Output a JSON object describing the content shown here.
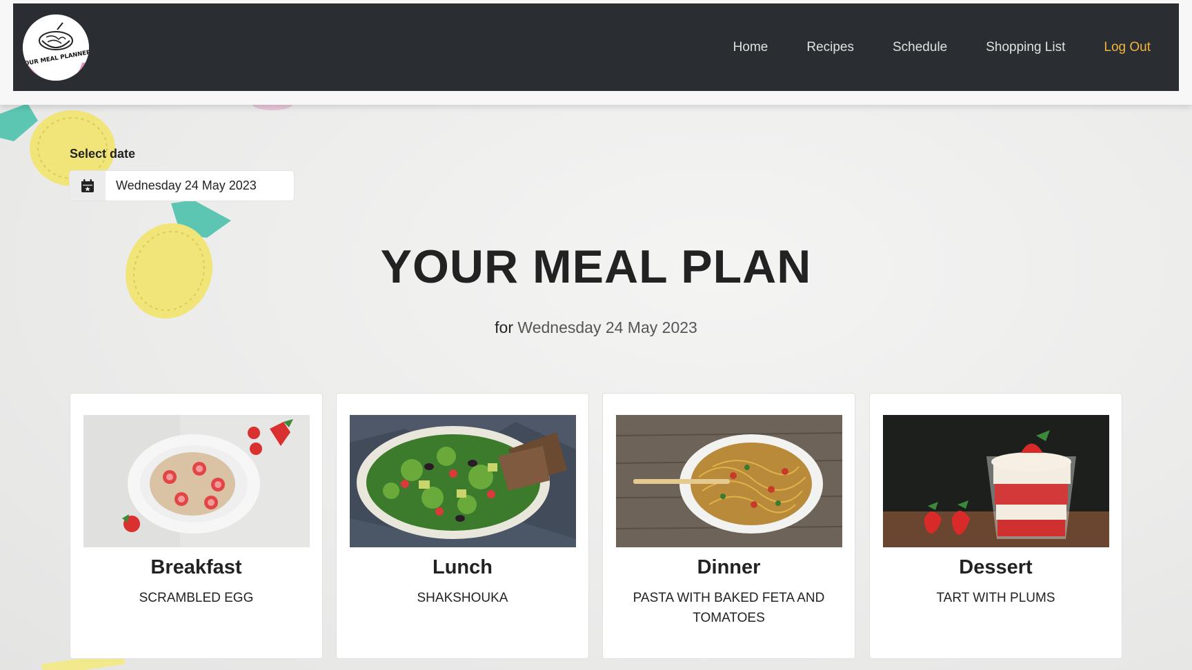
{
  "brand": {
    "logo_text": "YOUR MEAL PLANNER"
  },
  "nav": {
    "items": [
      "Home",
      "Recipes",
      "Schedule",
      "Shopping List"
    ],
    "logout": "Log Out"
  },
  "date_select": {
    "label": "Select date",
    "value": "Wednesday 24 May 2023",
    "icon": "calendar-icon"
  },
  "plan": {
    "title": "YOUR MEAL PLAN",
    "for_label": "for",
    "date": "Wednesday 24 May 2023"
  },
  "meals": [
    {
      "meal": "Breakfast",
      "dish": "SCRAMBLED EGG"
    },
    {
      "meal": "Lunch",
      "dish": "SHAKSHOUKA"
    },
    {
      "meal": "Dinner",
      "dish": "PASTA WITH BAKED FETA AND TOMATOES"
    },
    {
      "meal": "Dessert",
      "dish": "TART WITH PLUMS"
    }
  ],
  "colors": {
    "navbar": "#2a2e33",
    "nav_text": "#dfe1e3",
    "logout_accent": "#f3b53c",
    "page_bg": "#ececeb"
  }
}
